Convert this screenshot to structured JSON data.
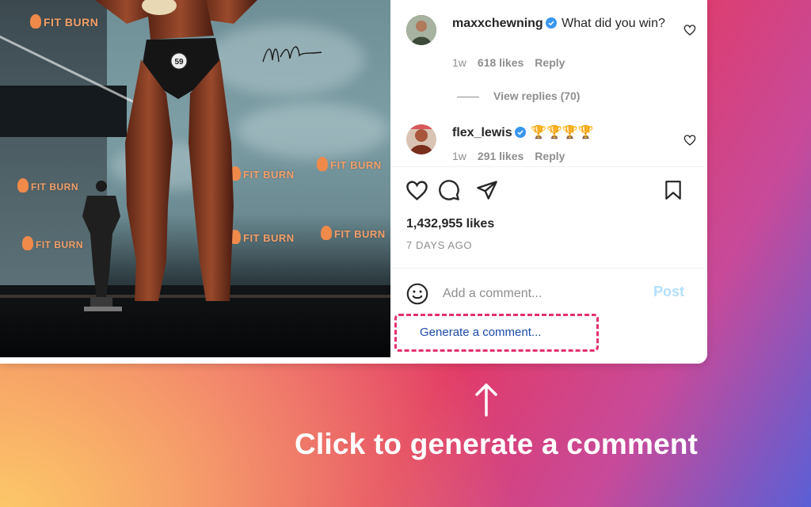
{
  "post": {
    "photo": {
      "banner_text": "FIT BURN",
      "bib_number": "59"
    }
  },
  "comments": [
    {
      "username": "maxxchewning",
      "verified": true,
      "text": "What did you win?",
      "time": "1w",
      "likes": "618 likes",
      "reply": "Reply"
    },
    {
      "username": "flex_lewis",
      "verified": true,
      "text": "🏆🏆🏆🏆",
      "time": "1w",
      "likes": "291 likes",
      "reply": "Reply"
    }
  ],
  "view_replies": "View replies (70)",
  "actions": {
    "icons": [
      "heart-icon",
      "comment-icon",
      "share-icon",
      "bookmark-icon"
    ]
  },
  "likes_count": "1,432,955 likes",
  "posted_ago": "7 DAYS AGO",
  "comment_box": {
    "placeholder": "Add a comment...",
    "post_label": "Post",
    "generate_label": "Generate a comment..."
  },
  "callout": {
    "text": "Click to generate a comment"
  },
  "colors": {
    "verified": "#3897f0",
    "generate_link": "#1b4aa8",
    "highlight_border": "#e3316b",
    "post_disabled": "#b2dffc"
  }
}
